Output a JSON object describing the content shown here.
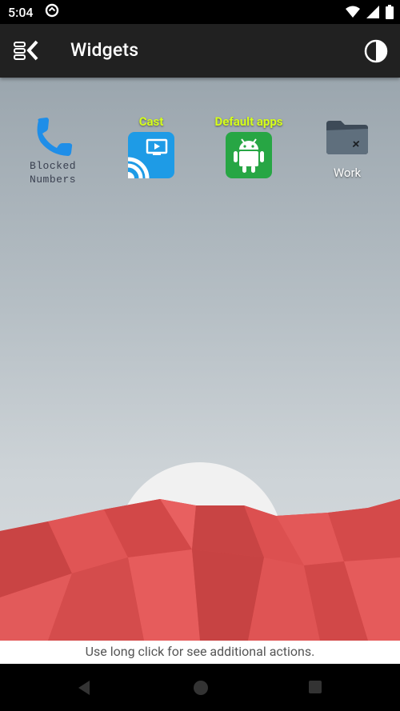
{
  "status_bar": {
    "time": "5:04",
    "icons": [
      "sync-circle-icon",
      "wifi-icon",
      "signal-icon",
      "battery-icon"
    ]
  },
  "app_bar": {
    "title": "Widgets",
    "left_icon": "menu-collapse-icon",
    "right_icon": "theme-toggle-icon"
  },
  "widgets": [
    {
      "name": "blocked-numbers",
      "line1": "Blocked",
      "line2": "Numbers",
      "icon": "phone-icon"
    },
    {
      "name": "cast",
      "label": "Cast",
      "icon": "cast-icon"
    },
    {
      "name": "default-apps",
      "label": "Default apps",
      "icon": "android-icon"
    },
    {
      "name": "work",
      "label": "Work",
      "icon": "folder-icon"
    }
  ],
  "hint": "Use long click for see additional actions.",
  "nav": {
    "back": "back-icon",
    "home": "home-icon",
    "recents": "recents-icon"
  },
  "colors": {
    "app_bar": "#212121",
    "label_accent": "#d6ff1a",
    "mountain": "#e05252",
    "cast_tile": "#1e9be6",
    "android_tile": "#27a644"
  }
}
